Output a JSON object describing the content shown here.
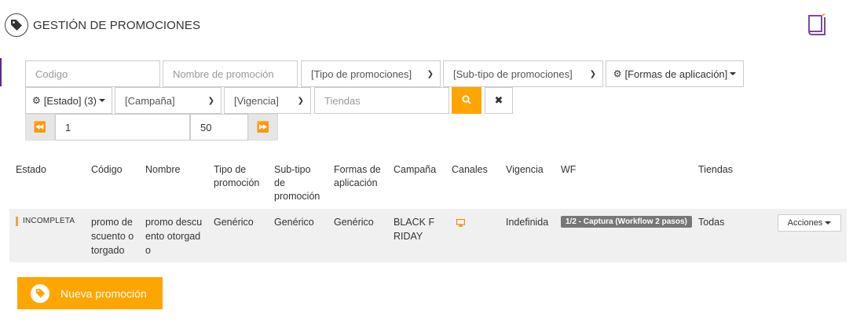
{
  "header": {
    "title": "GESTIÓN DE PROMOCIONES"
  },
  "filters": {
    "codigo_placeholder": "Codigo",
    "nombre_placeholder": "Nombre de promoción",
    "tipo": "[Tipo de promociones]",
    "subtipo": "[Sub-tipo de promociones]",
    "formas": "[Formas de aplicación]",
    "estado": "[Estado] (3)",
    "campana": "[Campaña]",
    "vigencia": "[Vigencia]",
    "tiendas_placeholder": "Tiendas"
  },
  "pager": {
    "page": "1",
    "page_size": "50"
  },
  "table": {
    "headers": {
      "estado": "Estado",
      "codigo": "Código",
      "nombre": "Nombre",
      "tipo_1": "Tipo de",
      "tipo_2": "promoción",
      "subtipo_1": "Sub-tipo",
      "subtipo_2": "de",
      "subtipo_3": "promoción",
      "formas_1": "Formas de",
      "formas_2": "aplicación",
      "campana": "Campaña",
      "canales": "Canales",
      "vigencia": "Vigencia",
      "wf": "WF",
      "tiendas": "Tiendas"
    },
    "rows": [
      {
        "estado": "INCOMPLETA",
        "codigo_1": "promo de",
        "codigo_2": "scuento o",
        "codigo_3": "torgado",
        "nombre_1": "promo descu",
        "nombre_2": "ento otorgad",
        "nombre_3": "o",
        "tipo": "Genérico",
        "subtipo": "Genérico",
        "formas": "Genérico",
        "campana_1": "BLACK F",
        "campana_2": "RIDAY",
        "canal_icon": "monitor-icon",
        "vigencia": "Indefinida",
        "wf": "1/2 - Captura (Workflow 2 pasos)",
        "tiendas": "Todas",
        "acciones": "Acciones"
      }
    ]
  },
  "new_button": {
    "label": "Nueva promoción"
  },
  "colors": {
    "accent": "#ffa500",
    "brand": "#5b2a86",
    "status_incompleta": "#f0a040"
  }
}
